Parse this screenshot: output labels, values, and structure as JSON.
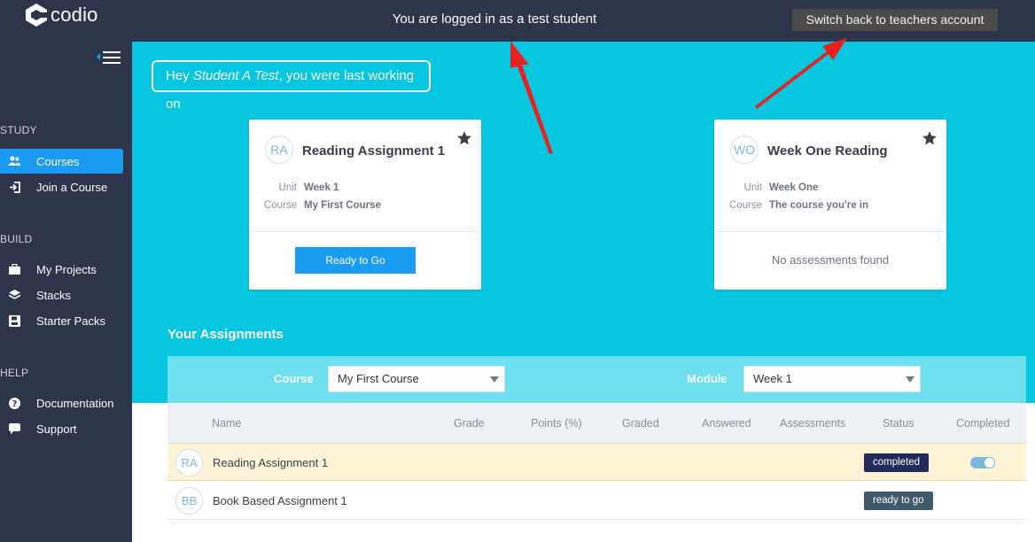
{
  "app": {
    "logo_text": "codio"
  },
  "topbar": {
    "login_message": "You are logged in as a test student",
    "switch_button": "Switch back to teachers account"
  },
  "sidebar": {
    "sections": [
      {
        "heading": "STUDY",
        "items": [
          {
            "label": "Courses",
            "icon": "users-icon",
            "active": true
          },
          {
            "label": "Join a Course",
            "icon": "sign-in-icon",
            "active": false
          }
        ]
      },
      {
        "heading": "BUILD",
        "items": [
          {
            "label": "My Projects",
            "icon": "briefcase-icon",
            "active": false
          },
          {
            "label": "Stacks",
            "icon": "layers-icon",
            "active": false
          },
          {
            "label": "Starter Packs",
            "icon": "save-icon",
            "active": false
          }
        ]
      },
      {
        "heading": "HELP",
        "items": [
          {
            "label": "Documentation",
            "icon": "question-icon",
            "active": false
          },
          {
            "label": "Support",
            "icon": "comment-icon",
            "active": false
          }
        ]
      }
    ]
  },
  "greeting": {
    "prefix": "Hey ",
    "name": "Student A Test",
    "suffix": ", you were last working on"
  },
  "cards": [
    {
      "initials": "RA",
      "title": "Reading Assignment 1",
      "unit_label": "Unit",
      "unit": "Week 1",
      "course_label": "Course",
      "course": "My First Course",
      "action": "Ready to Go"
    },
    {
      "initials": "WO",
      "title": "Week One Reading",
      "unit_label": "Unit",
      "unit": "Week One",
      "course_label": "Course",
      "course": "The course you're in",
      "empty_text": "No assessments found"
    }
  ],
  "assignments": {
    "heading": "Your Assignments",
    "filters": {
      "course_label": "Course",
      "course_value": "My First Course",
      "module_label": "Module",
      "module_value": "Week 1"
    },
    "columns": [
      "Name",
      "Grade",
      "Points (%)",
      "Graded",
      "Answered",
      "Assessments",
      "Status",
      "Completed"
    ],
    "rows": [
      {
        "initials": "RA",
        "name": "Reading Assignment 1",
        "status": "completed",
        "status_color": "#232a5c",
        "completed": true
      },
      {
        "initials": "BB",
        "name": "Book Based Assignment 1",
        "status": "ready to go",
        "status_color": "#3f5a6b",
        "completed": false
      }
    ]
  },
  "colors": {
    "accent": "#1a9bf2",
    "hero": "#07c7e0",
    "sidebar": "#2c3549",
    "annotation_arrow": "#e8201e"
  }
}
